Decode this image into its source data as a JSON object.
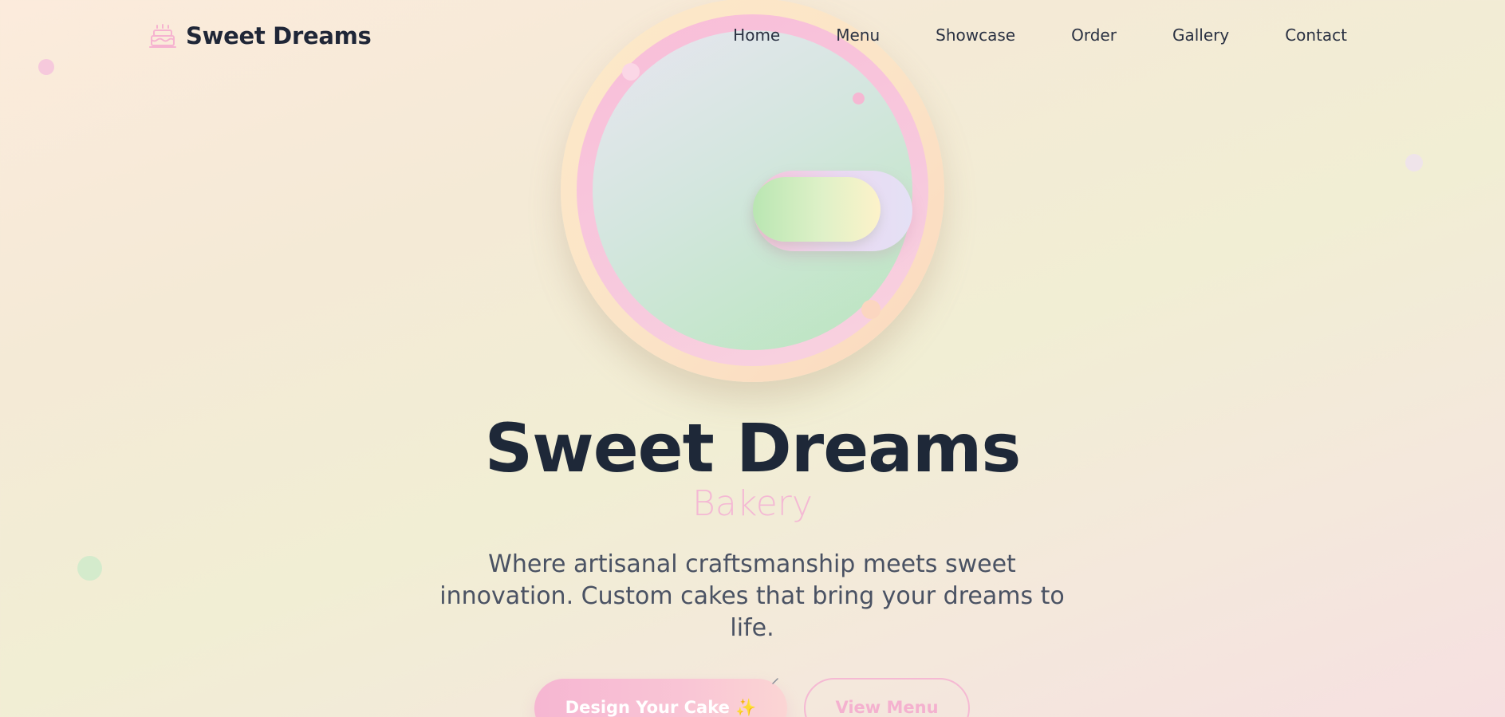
{
  "nav": {
    "brand_icon": "birthday-cake-icon",
    "brand_name": "Sweet Dreams",
    "links": [
      "Home",
      "Menu",
      "Showcase",
      "Order",
      "Gallery",
      "Contact"
    ]
  },
  "hero": {
    "title": "Sweet Dreams",
    "subtitle": "Bakery",
    "description": "Where artisanal craftsmanship meets sweet innovation. Custom cakes that bring your dreams to life.",
    "toggle_state": "on"
  },
  "buttons": {
    "primary_label": "Design Your Cake ✨",
    "secondary_label": "View Menu"
  },
  "colors": {
    "text_dark": "#1e2838",
    "accent_pink": "#f4b8d4",
    "accent_green": "#b9e6b2",
    "accent_cream": "#fde9c8"
  }
}
